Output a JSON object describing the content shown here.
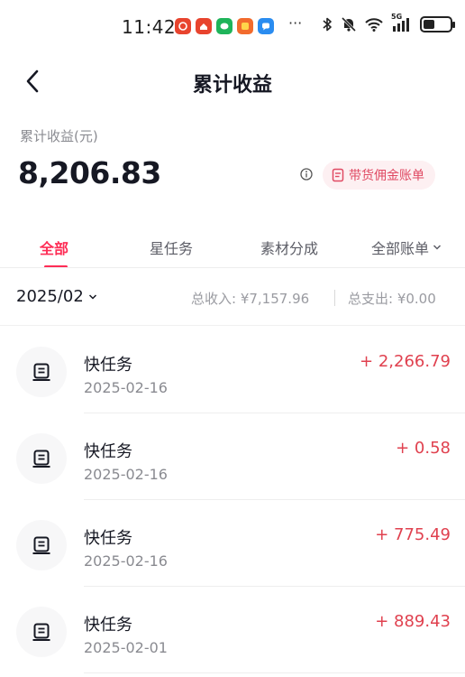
{
  "status_bar": {
    "time": "11:42",
    "more": "···",
    "network": "5G",
    "app_icons": [
      {
        "name": "app-icon-red-1",
        "color": "#e8442e"
      },
      {
        "name": "app-icon-red-2",
        "color": "#e8442e"
      },
      {
        "name": "app-icon-green",
        "color": "#1fb45a"
      },
      {
        "name": "app-icon-orange",
        "color": "#f26b2d"
      },
      {
        "name": "app-icon-blue",
        "color": "#2a8cf0"
      }
    ]
  },
  "nav": {
    "title": "累计收益",
    "back_icon": "chevron-left-icon"
  },
  "summary": {
    "label": "累计收益(元)",
    "value": "8,206.83",
    "bill_button": "带货佣金账单"
  },
  "tabs": [
    {
      "label": "全部",
      "active": true
    },
    {
      "label": "星任务",
      "active": false
    },
    {
      "label": "素材分成",
      "active": false
    },
    {
      "label": "全部账单",
      "active": false
    }
  ],
  "month_row": {
    "month": "2025/02",
    "income": "总收入: ¥7,157.96",
    "expense": "总支出: ¥0.00"
  },
  "items": [
    {
      "title": "快任务",
      "date": "2025-02-16",
      "amount": "+ 2,266.79"
    },
    {
      "title": "快任务",
      "date": "2025-02-16",
      "amount": "+ 0.58"
    },
    {
      "title": "快任务",
      "date": "2025-02-16",
      "amount": "+ 775.49"
    },
    {
      "title": "快任务",
      "date": "2025-02-01",
      "amount": "+ 889.43"
    }
  ],
  "colors": {
    "accent": "#fe2c55",
    "amount": "#e0414f",
    "chip_bg": "#fdf0f2"
  }
}
